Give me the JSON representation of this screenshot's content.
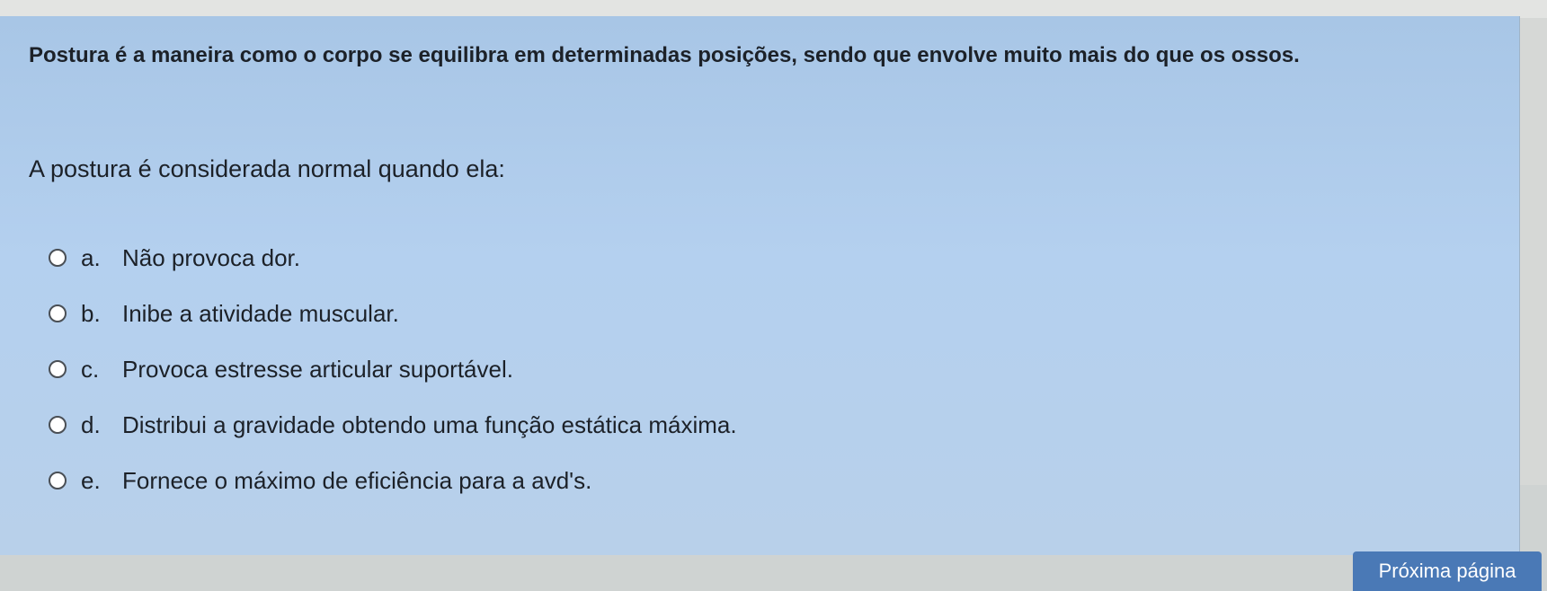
{
  "question": {
    "intro": "Postura é a maneira como o corpo se equilibra em determinadas posições, sendo que envolve muito mais do que os ossos.",
    "prompt": "A postura é considerada normal quando ela:",
    "options": [
      {
        "letter": "a.",
        "text": "Não provoca dor."
      },
      {
        "letter": "b.",
        "text": "Inibe a atividade muscular."
      },
      {
        "letter": "c.",
        "text": "Provoca estresse articular suportável."
      },
      {
        "letter": "d.",
        "text": "Distribui a gravidade obtendo uma função estática máxima."
      },
      {
        "letter": "e.",
        "text": "Fornece o máximo de eficiência para a avd's."
      }
    ]
  },
  "navigation": {
    "next_label": "Próxima página"
  },
  "colors": {
    "panel": "#b4d0ef",
    "button": "#4a79b6"
  }
}
